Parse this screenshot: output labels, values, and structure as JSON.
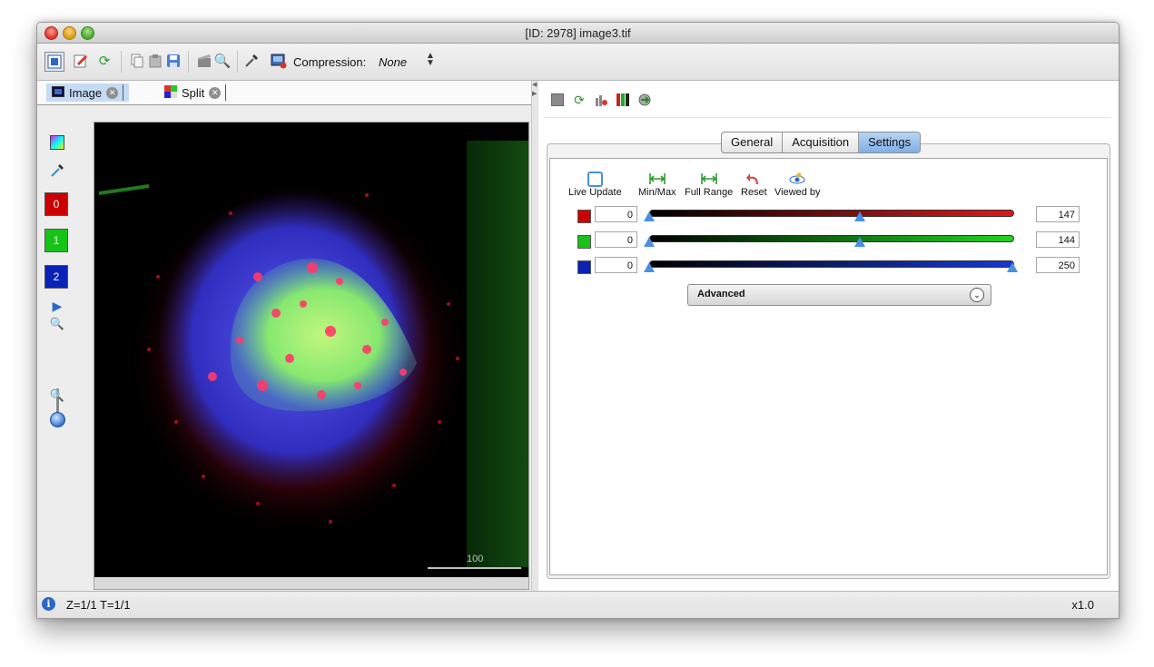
{
  "window": {
    "title": "[ID: 2978] image3.tif"
  },
  "toolbar": {
    "icons": [
      "viewer-icon",
      "edit-icon",
      "refresh-icon",
      "copy-icon",
      "paste-icon",
      "save-icon",
      "movie-icon",
      "zoom-search-icon",
      "pipette-icon",
      "compression-icon"
    ],
    "compression_label": "Compression:",
    "compression_value": "None"
  },
  "image_tabs": [
    {
      "label": "Image",
      "active": true
    },
    {
      "label": "Split",
      "active": false
    }
  ],
  "channels": [
    {
      "label": "0",
      "color": "#cc0000",
      "min": "0",
      "max": "147",
      "thumb_pos": 0.58,
      "track_color": "#e21818"
    },
    {
      "label": "1",
      "color": "#18c318",
      "min": "0",
      "max": "144",
      "thumb_pos": 0.58,
      "track_color": "#22d422"
    },
    {
      "label": "2",
      "color": "#0a22b8",
      "min": "0",
      "max": "250",
      "thumb_pos": 1.0,
      "track_color": "#1638d8"
    }
  ],
  "viewer": {
    "scale_bar_label": "100"
  },
  "settings": {
    "tabs": [
      {
        "label": "General",
        "active": false
      },
      {
        "label": "Acquisition",
        "active": false
      },
      {
        "label": "Settings",
        "active": true
      }
    ],
    "live_update_label": "Live Update",
    "minmax_label": "Min/Max",
    "full_range_label": "Full Range",
    "reset_label": "Reset",
    "viewed_by_label": "Viewed by",
    "advanced_label": "Advanced"
  },
  "status": {
    "position": "Z=1/1 T=1/1",
    "zoom": "x1.0"
  }
}
